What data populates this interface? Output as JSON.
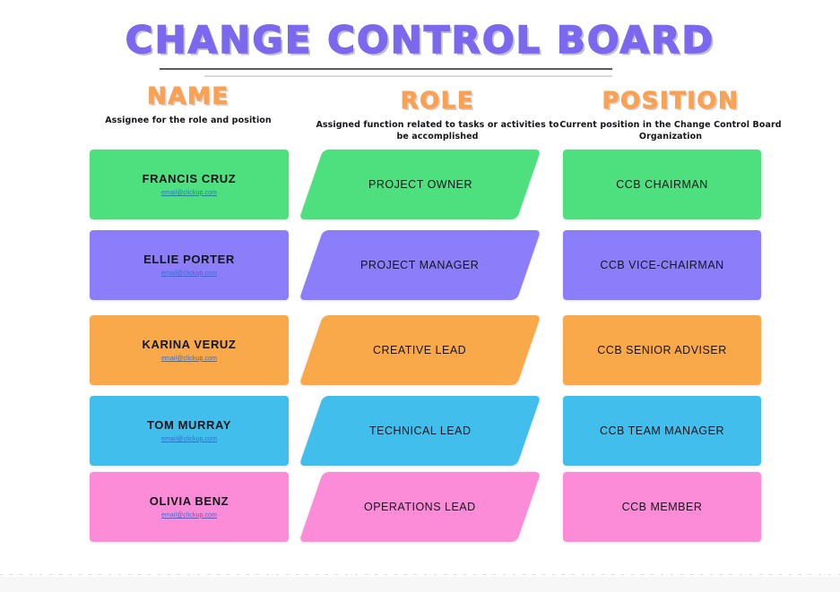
{
  "title": "CHANGE CONTROL BOARD",
  "columns": [
    {
      "key": "name",
      "heading": "NAME",
      "subtitle": "Assignee for the role and position"
    },
    {
      "key": "role",
      "heading": "ROLE",
      "subtitle": "Assigned function related to tasks or activities to be accomplished"
    },
    {
      "key": "position",
      "heading": "POSITION",
      "subtitle": "Current position in the Change Control Board Organization"
    }
  ],
  "colors": {
    "title": "#7b68ee",
    "heading": "#f9a256",
    "green": "#4ee07f",
    "purple": "#8c7dfa",
    "orange": "#f9a949",
    "blue": "#42beec",
    "pink": "#fc8bd8",
    "email_link": "#2f6fd0"
  },
  "rows": [
    {
      "color": "#4ee07f",
      "name": "FRANCIS CRUZ",
      "email": "email@clickup.com",
      "role": "PROJECT OWNER",
      "position": "CCB CHAIRMAN"
    },
    {
      "color": "#8c7dfa",
      "name": "ELLIE PORTER",
      "email": "email@clickup.com",
      "role": "PROJECT MANAGER",
      "position": "CCB VICE-CHAIRMAN"
    },
    {
      "color": "#f9a949",
      "name": "KARINA VERUZ",
      "email": "email@clickup.com",
      "role": "CREATIVE LEAD",
      "position": "CCB SENIOR ADVISER"
    },
    {
      "color": "#42beec",
      "name": "TOM MURRAY",
      "email": "email@clickup.com",
      "role": "TECHNICAL LEAD",
      "position": "CCB TEAM MANAGER"
    },
    {
      "color": "#fc8bd8",
      "name": "OLIVIA BENZ",
      "email": "email@clickup.com",
      "role": "OPERATIONS LEAD",
      "position": "CCB MEMBER"
    }
  ]
}
